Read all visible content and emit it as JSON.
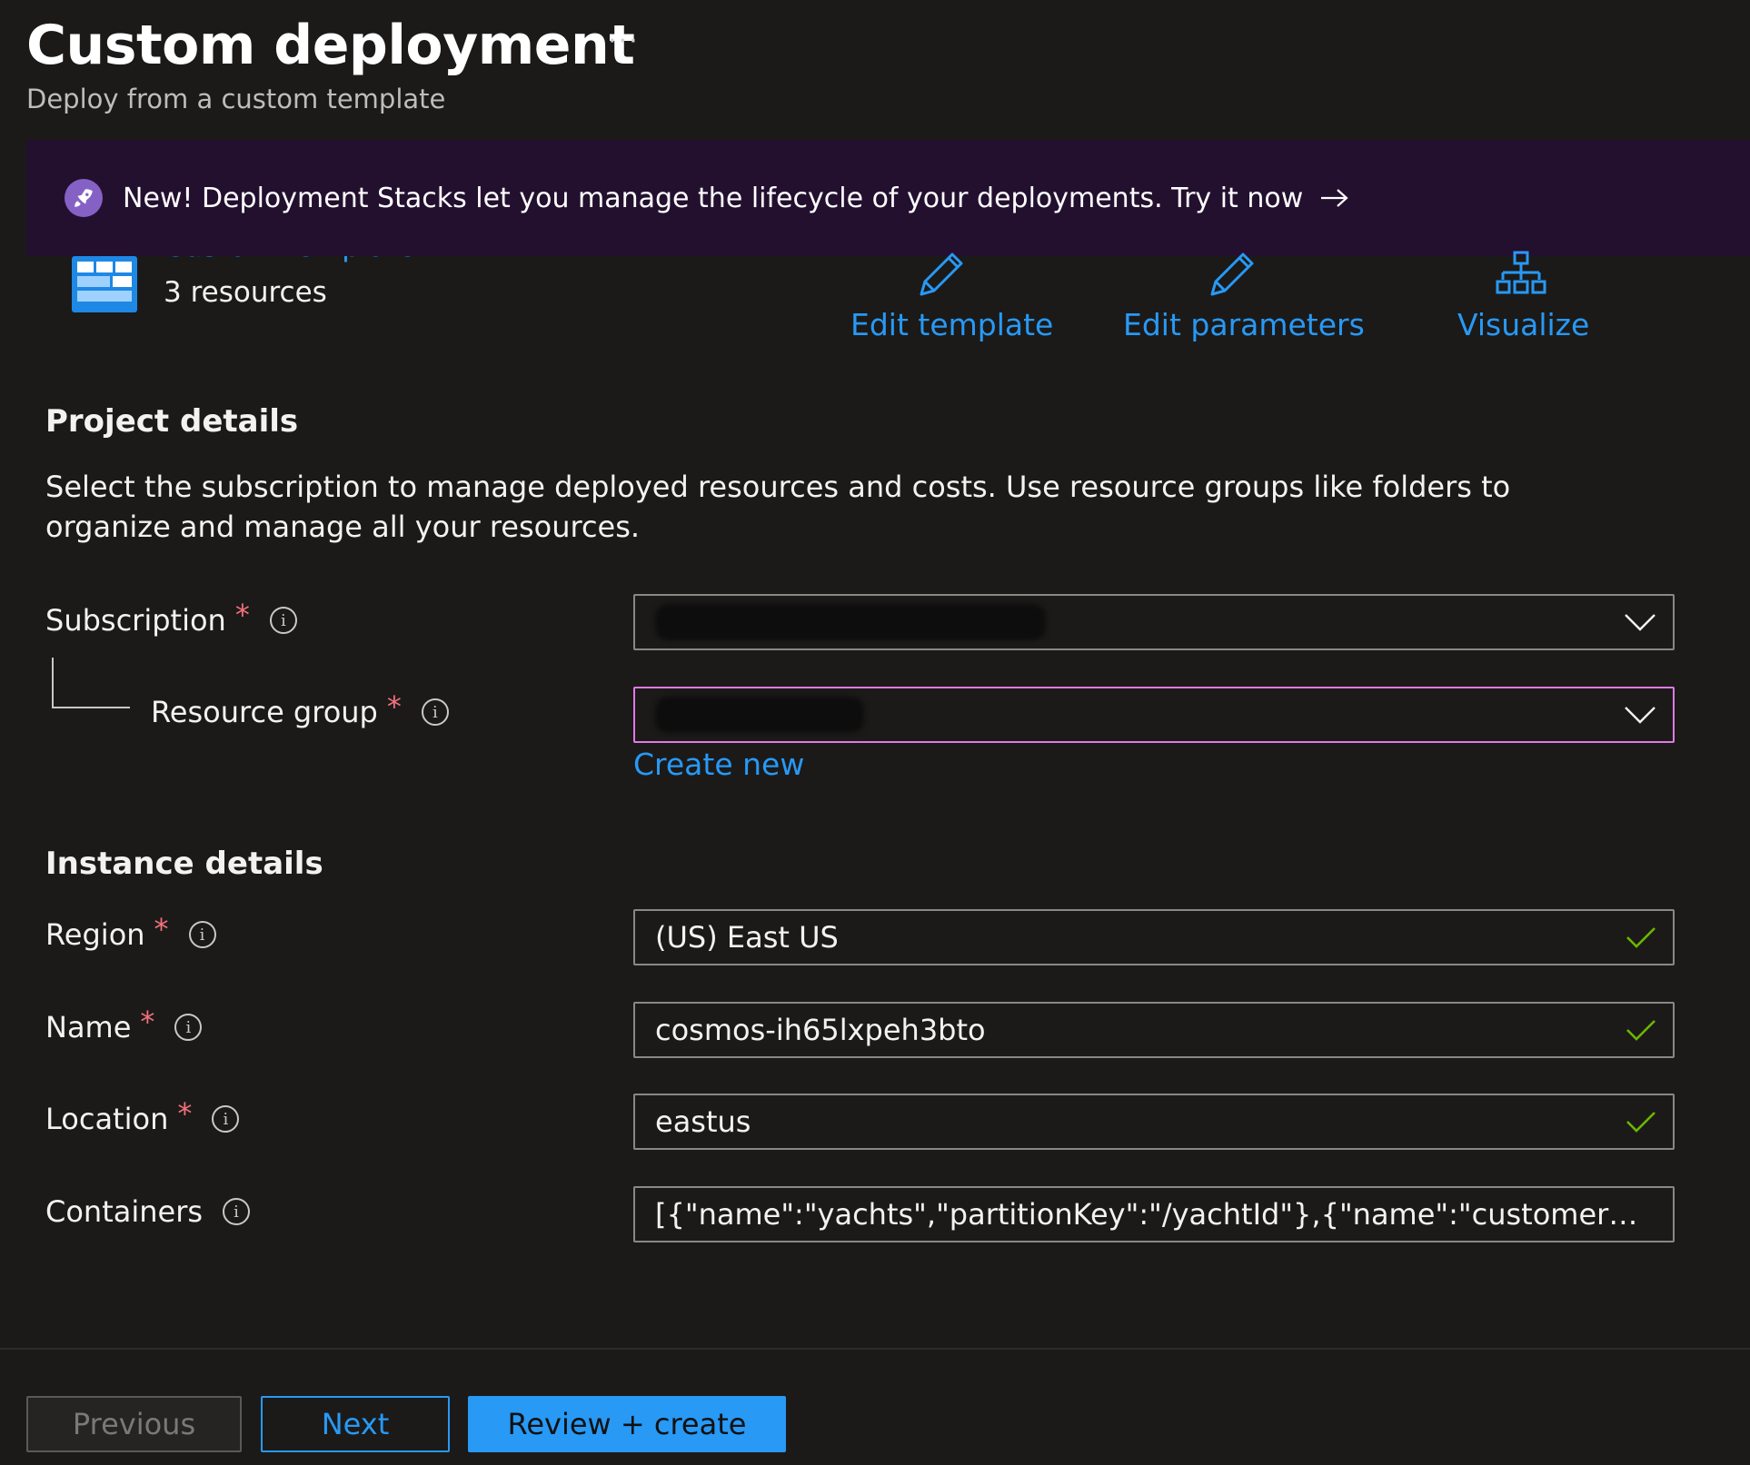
{
  "header": {
    "title": "Custom deployment",
    "more_label": "···",
    "subtitle": "Deploy from a custom template"
  },
  "banner": {
    "text": "New! Deployment Stacks let you manage the lifecycle of your deployments. Try it now",
    "icon": "rocket-icon",
    "accent_color": "#23102f"
  },
  "template": {
    "link_label": "Custom template",
    "resources": "3 resources"
  },
  "actions": [
    {
      "label": "Edit template",
      "icon": "pencil-icon"
    },
    {
      "label": "Edit parameters",
      "icon": "pencil-icon"
    },
    {
      "label": "Visualize",
      "icon": "hierarchy-icon"
    }
  ],
  "project": {
    "title": "Project details",
    "description": "Select the subscription to manage deployed resources and costs. Use resource groups like folders to organize and manage all your resources.",
    "subscription": {
      "label": "Subscription",
      "required": "*",
      "value": ""
    },
    "resource_group": {
      "label": "Resource group",
      "required": "*",
      "value": "",
      "create_new": "Create new"
    }
  },
  "instance": {
    "title": "Instance details",
    "region": {
      "label": "Region",
      "required": "*",
      "value": "(US) East US"
    },
    "name": {
      "label": "Name",
      "required": "*",
      "value": "cosmos-ih65lxpeh3bto"
    },
    "location": {
      "label": "Location",
      "required": "*",
      "value": "eastus"
    },
    "containers": {
      "label": "Containers",
      "value": "[{\"name\":\"yachts\",\"partitionKey\":\"/yachtId\"},{\"name\":\"customers\",\"partiti..."
    }
  },
  "footer": {
    "previous": "Previous",
    "next": "Next",
    "review_create": "Review + create"
  },
  "colors": {
    "background": "#1b1a19",
    "link": "#2899f5",
    "required": "#f1707b",
    "focus_border": "#e07ae5",
    "valid_check": "#6bb700"
  }
}
